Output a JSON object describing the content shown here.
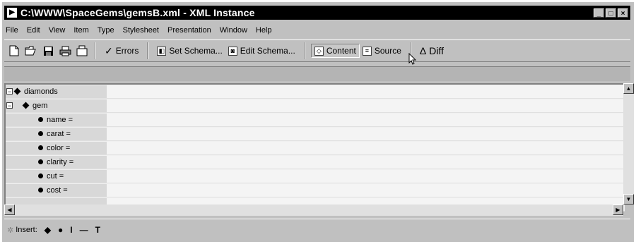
{
  "window": {
    "title": "C:\\WWW\\SpaceGems\\gemsB.xml - XML Instance",
    "controls": [
      "_",
      "□",
      "×"
    ]
  },
  "menu": [
    {
      "label": "File"
    },
    {
      "label": "Edit"
    },
    {
      "label": "View"
    },
    {
      "label": "Item"
    },
    {
      "label": "Type"
    },
    {
      "label": "Stylesheet"
    },
    {
      "label": "Presentation"
    },
    {
      "label": "Window"
    },
    {
      "label": "Help"
    }
  ],
  "toolbar": {
    "icons": [
      "new-file-icon",
      "open-file-icon",
      "save-icon",
      "print-icon",
      "print-preview-icon"
    ],
    "errors_label": "Errors",
    "set_schema_label": "Set Schema...",
    "edit_schema_label": "Edit Schema...",
    "content_label": "Content",
    "source_label": "Source",
    "diff_label": "Diff",
    "active_view": "Content"
  },
  "tree": {
    "rows": [
      {
        "label": "diamonds",
        "kind": "element",
        "expander": "−",
        "indent": 0
      },
      {
        "label": "gem",
        "kind": "element",
        "expander": "−",
        "indent": 1
      },
      {
        "label": "name =",
        "kind": "attribute",
        "indent": 2
      },
      {
        "label": "carat =",
        "kind": "attribute",
        "indent": 2
      },
      {
        "label": "color =",
        "kind": "attribute",
        "indent": 2
      },
      {
        "label": "clarity =",
        "kind": "attribute",
        "indent": 2
      },
      {
        "label": "cut =",
        "kind": "attribute",
        "indent": 2
      },
      {
        "label": "cost =",
        "kind": "attribute",
        "indent": 2
      }
    ]
  },
  "statusbar": {
    "insert_label": "Insert:",
    "insert_items": [
      "◆",
      "●",
      "I",
      "—",
      "T"
    ]
  }
}
